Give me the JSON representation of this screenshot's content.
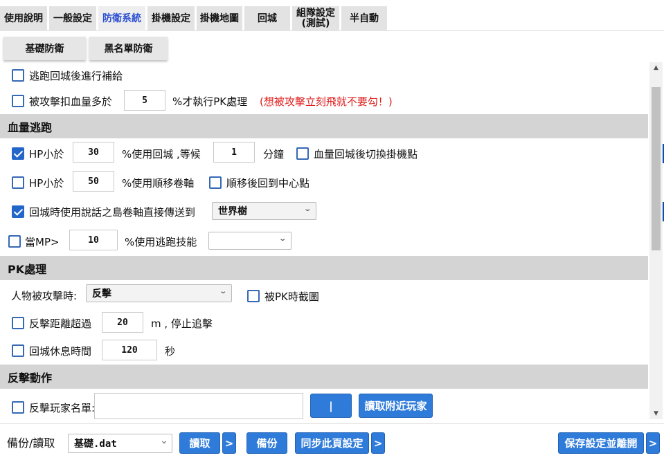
{
  "tabs": [
    {
      "label": "使用說明",
      "active": false
    },
    {
      "label": "一般設定",
      "active": false
    },
    {
      "label": "防衛系統",
      "active": true
    },
    {
      "label": "掛機設定",
      "active": false
    },
    {
      "label": "掛機地圖",
      "active": false
    },
    {
      "label": "回城",
      "active": false
    },
    {
      "label": "組隊設定\n(測試)",
      "active": false
    },
    {
      "label": "半自動",
      "active": false
    }
  ],
  "subtabs": [
    "基礎防衛",
    "黑名單防衛"
  ],
  "general": {
    "refill_after_escape": {
      "label": "逃跑回城後進行補給",
      "checked": false
    },
    "hp_drop": {
      "label": "被攻擊扣血量多於",
      "value": "5",
      "suffix": "%才執行PK處理",
      "warning": "(想被攻擊立刻飛就不要勾！)",
      "checked": false
    }
  },
  "hp_escape": {
    "title": "血量逃跑",
    "hp_town": {
      "label": "HP小於",
      "value": "30",
      "mid": "%使用回城 ,等候",
      "minutes": "1",
      "minutes_unit": "分鐘",
      "checked": true
    },
    "switch_spot": {
      "label": "血量回城後切換掛機點",
      "checked": false
    },
    "hp_teleport": {
      "label": "HP小於",
      "value": "50",
      "suffix": "%使用順移卷軸",
      "checked": false
    },
    "return_center": {
      "label": "順移後回到中心點",
      "checked": false
    },
    "scroll_transfer": {
      "label": "回城時使用說話之島卷軸直接傳送到",
      "selected": "世界樹",
      "checked": true
    },
    "mp_skill": {
      "label": "當MP>",
      "value": "10",
      "suffix": "%使用逃跑技能",
      "selected": "",
      "checked": false
    }
  },
  "pk": {
    "title": "PK處理",
    "on_attacked_label": "人物被攻擊時:",
    "on_attacked_selected": "反擊",
    "screenshot": {
      "label": "被PK時截圖",
      "checked": false
    },
    "chase": {
      "label": "反擊距離超過",
      "value": "20",
      "suffix": "m , 停止追擊",
      "checked": false
    },
    "rest": {
      "label": "回城休息時間",
      "value": "120",
      "suffix": "秒",
      "checked": false
    }
  },
  "counter": {
    "title": "反擊動作",
    "player_list": {
      "label": "反擊玩家名單:",
      "value": "",
      "checked": false
    },
    "separator_button": "|",
    "read_nearby_button": "讀取附近玩家"
  },
  "footer": {
    "backup_label": "備份/讀取",
    "file_selected": "基礎.dat",
    "read_button": "讀取",
    "more1": ">",
    "backup_button": "備份",
    "sync_button": "同步此頁設定",
    "more2": ">",
    "save_button": "保存設定並離開",
    "more3": ">"
  },
  "icons": {
    "checkbox_color": "#2366c9",
    "button_color": "#2f7bd9",
    "warning_color": "#e01b1b"
  }
}
